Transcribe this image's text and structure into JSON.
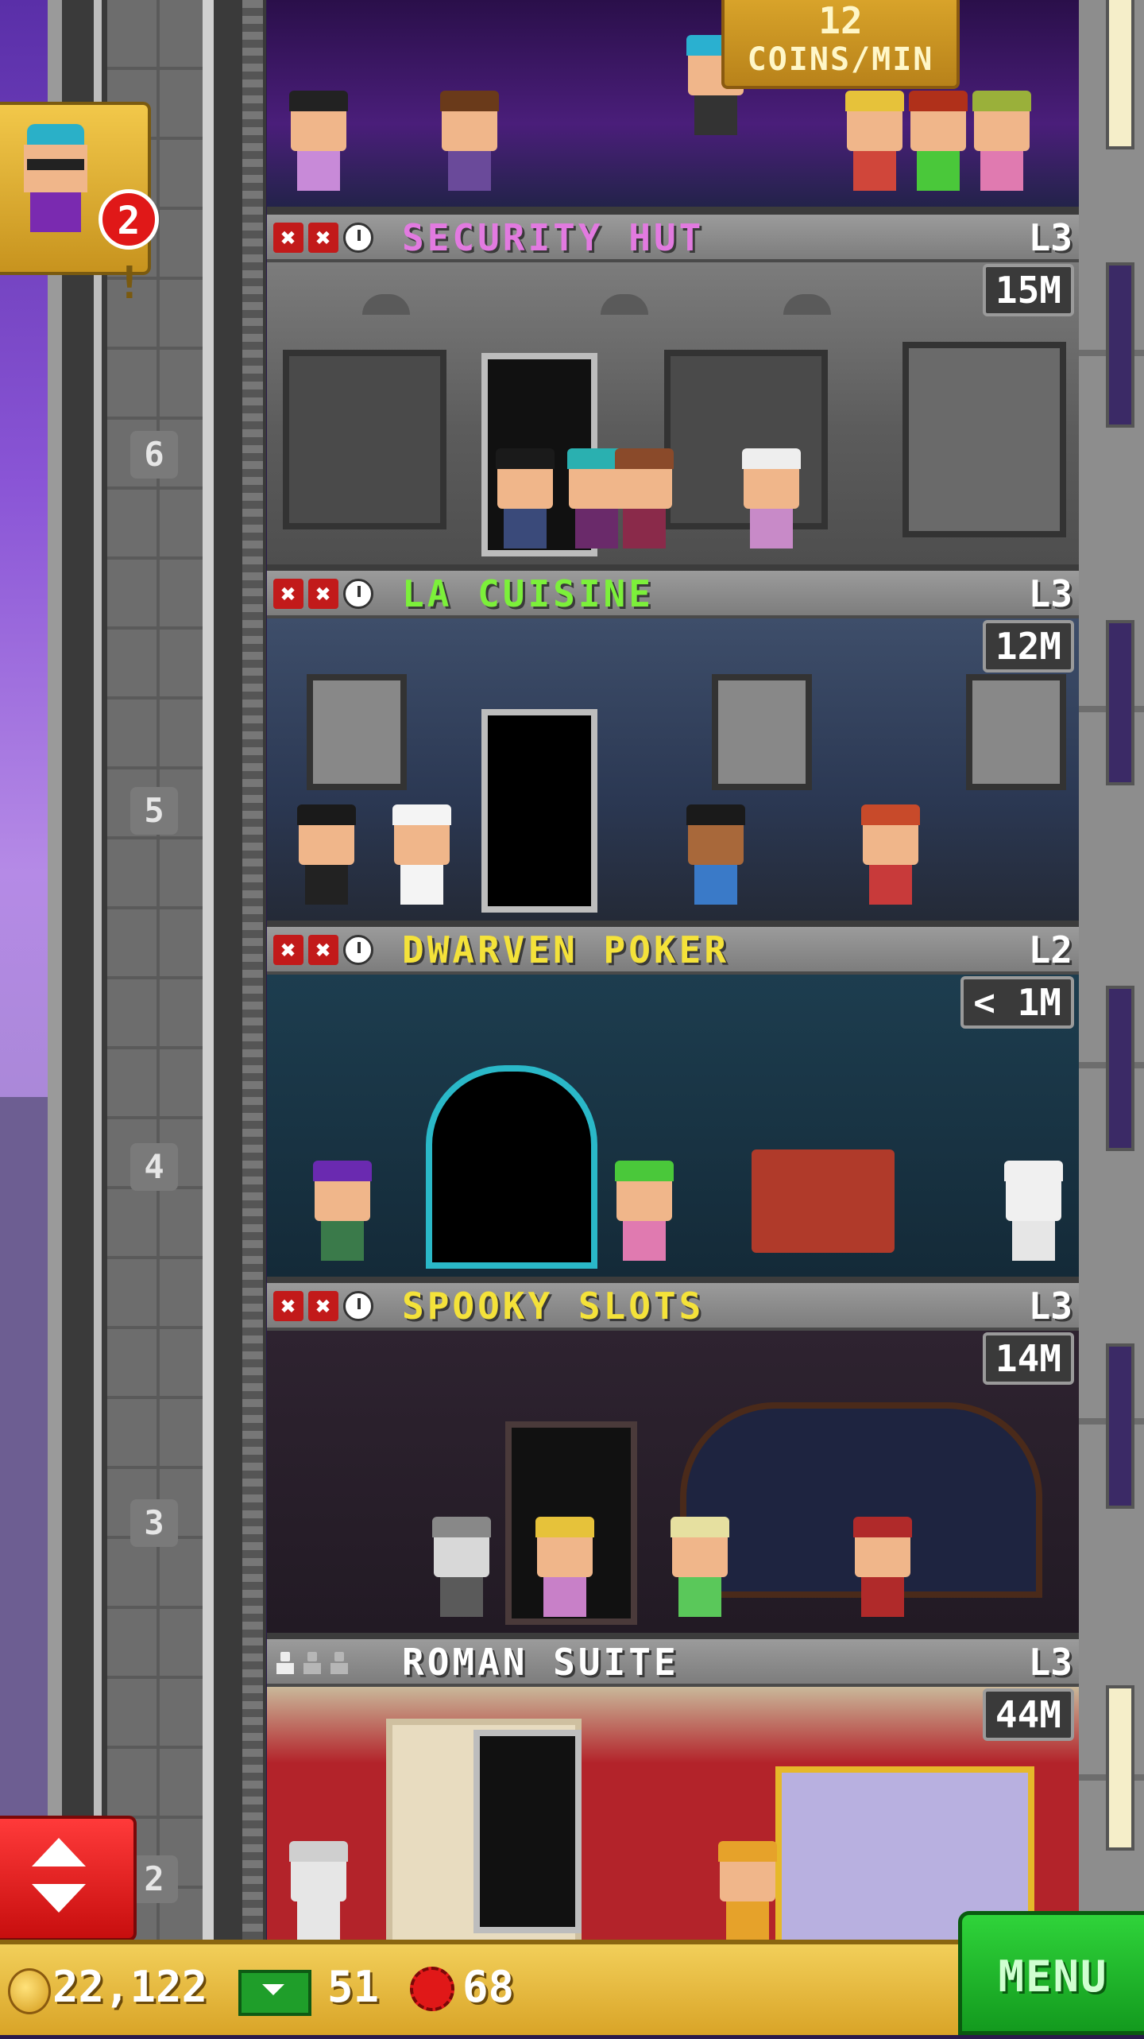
{
  "top_floor": {
    "coins_rate_value": "12",
    "coins_rate_unit": "COINS/MIN"
  },
  "notification": {
    "count": "2",
    "alert": "!"
  },
  "shaft_floor_numbers": [
    "6",
    "5",
    "4",
    "3",
    "2"
  ],
  "floors": [
    {
      "name": "SECURITY HUT",
      "level": "L3",
      "stock": "15M",
      "name_color": "#e27ae0",
      "status": "x x clock"
    },
    {
      "name": "LA CUISINE",
      "level": "L3",
      "stock": "12M",
      "name_color": "#7cf03a",
      "status": "x x clock"
    },
    {
      "name": "DWARVEN POKER",
      "level": "L2",
      "stock": "< 1M",
      "name_color": "#f4e23a",
      "status": "x x clock"
    },
    {
      "name": "SPOOKY SLOTS",
      "level": "L3",
      "stock": "14M",
      "name_color": "#f4e23a",
      "status": "x x clock"
    },
    {
      "name": "ROMAN SUITE",
      "level": "L3",
      "stock": "44M",
      "name_color": "#ffffff",
      "status": "1 of 3 residents"
    }
  ],
  "status_icon_labels": {
    "x": "✖"
  },
  "bottom_bar": {
    "coins": "22,122",
    "bux": "51",
    "gems": "68",
    "menu_label": "MENU"
  }
}
